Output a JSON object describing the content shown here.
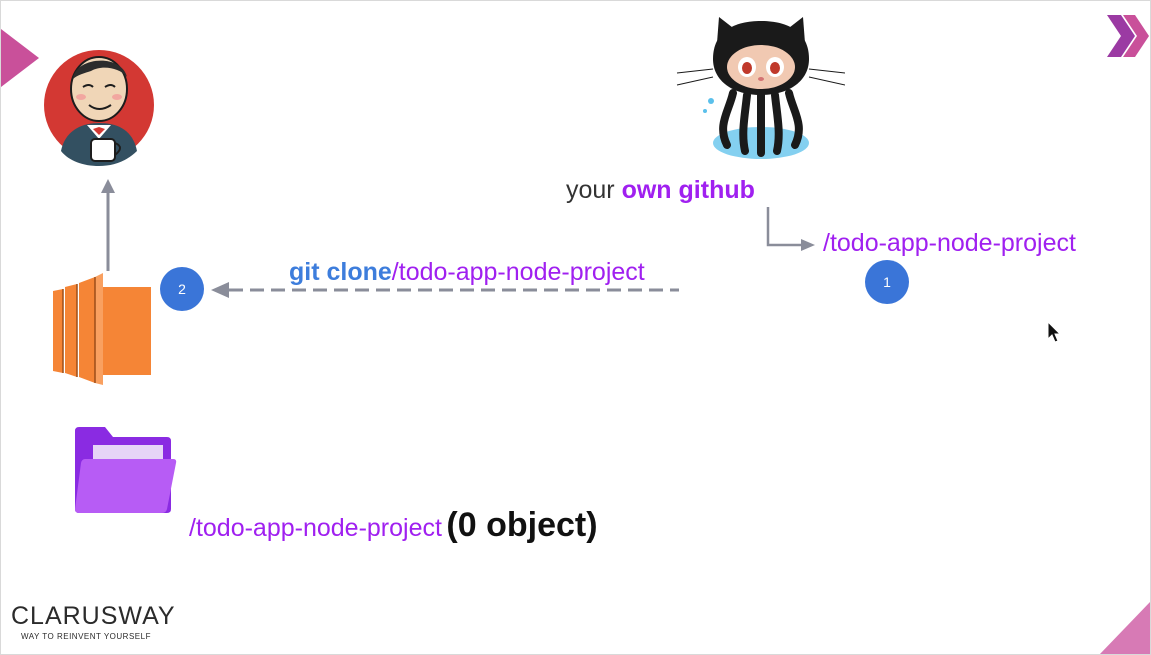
{
  "github": {
    "prefix": "your ",
    "highlight": "own github",
    "repo_path": "/todo-app-node-project",
    "step_number": "1"
  },
  "clone": {
    "command": "git clone",
    "repo_path": "/todo-app-node-project",
    "step_number": "2"
  },
  "local_folder": {
    "path": "/todo-app-node-project",
    "status": "(0 object)"
  },
  "brand": {
    "name": "CLARUSWAY",
    "tagline": "WAY TO REINVENT YOURSELF"
  },
  "icons": [
    "jenkins-icon",
    "octocat-icon",
    "ec2-server-icon",
    "folder-icon",
    "chevron-logo-icon",
    "mouse-cursor-icon"
  ],
  "colors": {
    "accent_purple": "#a020f0",
    "accent_blue": "#3d7ddc",
    "badge_blue": "#3a75d8",
    "server_orange": "#f58536",
    "slide_pink": "#c9509a",
    "arrow_gray": "#8a8d9a"
  }
}
